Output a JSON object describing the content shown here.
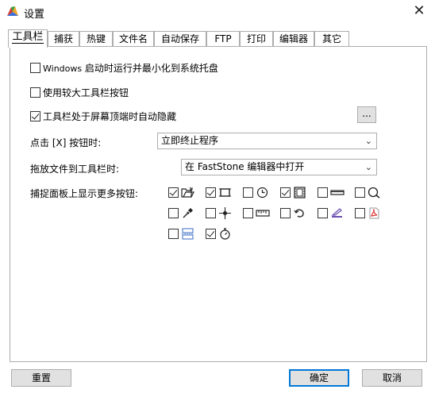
{
  "window": {
    "title": "设置",
    "close_glyph": "✕"
  },
  "tabs": [
    "工具栏",
    "捕获",
    "热键",
    "文件名",
    "自动保存",
    "FTP",
    "打印",
    "编辑器",
    "其它"
  ],
  "toolbar": {
    "opt_minimize_prefix": "Windows",
    "opt_minimize_rest": " 启动时运行并最小化到系统托盘",
    "opt_large_buttons": "使用较大工具栏按钮",
    "opt_autohide": "工具栏处于屏幕顶端时自动隐藏",
    "ellipsis": "...",
    "close_label": "点击 [X] 按钮时:",
    "close_value": "立即终止程序",
    "drop_label": "拖放文件到工具栏时:",
    "drop_value": "在 FastStone 编辑器中打开",
    "panel_label": "捕捉面板上显示更多按钮:"
  },
  "capture_buttons": [
    {
      "icon": "open-folder-icon",
      "checked": true
    },
    {
      "icon": "capture-region-icon",
      "checked": true
    },
    {
      "icon": "delay-clock-icon",
      "checked": false
    },
    {
      "icon": "video-film-icon",
      "checked": true
    },
    {
      "icon": "rectangle-bar-icon",
      "checked": false
    },
    {
      "icon": "magnifier-icon",
      "checked": false
    },
    {
      "icon": "color-picker-icon",
      "checked": false
    },
    {
      "icon": "crosshair-icon",
      "checked": false
    },
    {
      "icon": "ruler-icon",
      "checked": false
    },
    {
      "icon": "undo-curve-icon",
      "checked": false
    },
    {
      "icon": "scanner-icon",
      "checked": false
    },
    {
      "icon": "pdf-icon",
      "checked": false
    },
    {
      "icon": "split-screen-icon",
      "checked": false
    },
    {
      "icon": "timer-icon",
      "checked": true
    }
  ],
  "buttons": {
    "reset": "重置",
    "ok": "确定",
    "cancel": "取消"
  },
  "colors": {
    "accent": "#0078d7",
    "border": "#adadad",
    "button_face": "#e1e1e1"
  }
}
